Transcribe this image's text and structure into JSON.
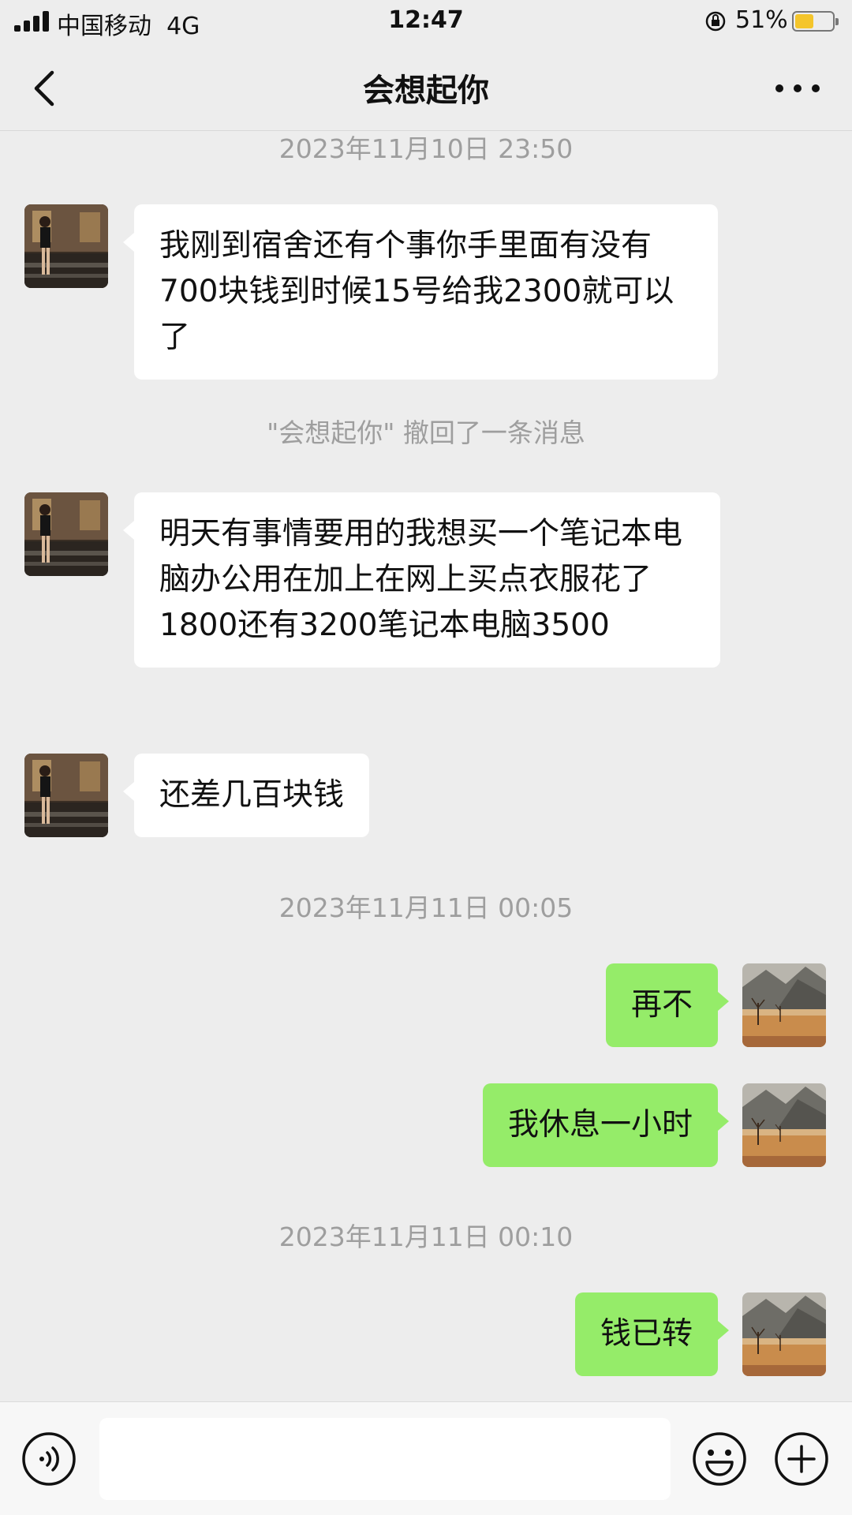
{
  "status_bar": {
    "carrier": "中国移动",
    "network": "4G",
    "time": "12:47",
    "battery_percent_label": "51%",
    "battery_level": 0.51
  },
  "header": {
    "title": "会想起你"
  },
  "messages": {
    "ts1": "2023年11月10日 23:50",
    "msg1": "我刚到宿舍还有个事你手里面有没有700块钱到时候15号给我2300就可以了",
    "recall_notice": "\"会想起你\" 撤回了一条消息",
    "msg2": "明天有事情要用的我想买一个笔记本电脑办公用在加上在网上买点衣服花了1800还有3200笔记本电脑3500",
    "msg3": "还差几百块钱",
    "ts2": "2023年11月11日 00:05",
    "msg4": "再不",
    "msg5": "我休息一小时",
    "ts3": "2023年11月11日 00:10",
    "msg6": "钱已转"
  },
  "input_bar": {
    "placeholder": ""
  },
  "colors": {
    "incoming_bubble": "#ffffff",
    "outgoing_bubble": "#95ec69",
    "background": "#ededed",
    "battery_fill": "#f4c52b"
  }
}
